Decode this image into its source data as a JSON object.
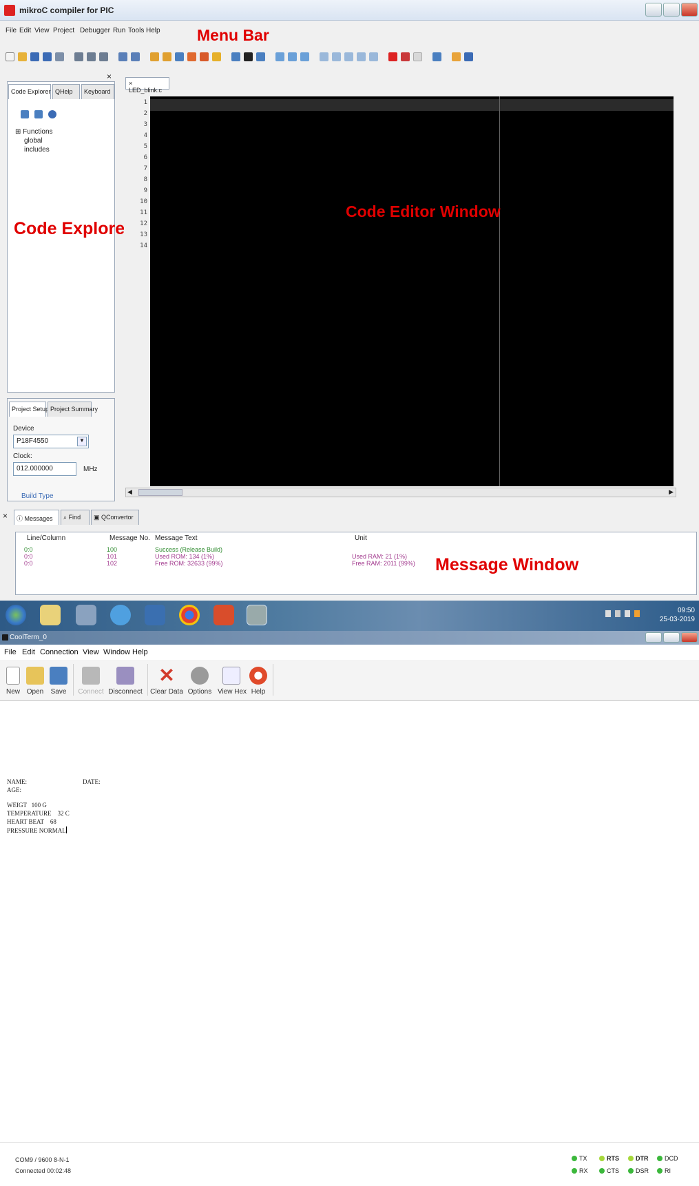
{
  "mikroc": {
    "title": "mikroC compiler for PIC",
    "menu": [
      "File",
      "Edit",
      "View",
      "Project",
      "Debugger",
      "Run",
      "Tools",
      "Help"
    ],
    "annotations": {
      "menu_bar": "Menu Bar",
      "code_explorer": "Code Explorer",
      "code_editor": "Code Editor Window",
      "message_window": "Message Window"
    },
    "explorer_tabs": [
      "Code Explorer",
      "QHelp",
      "Keyboard"
    ],
    "explorer_tree": [
      "Functions",
      "global",
      "includes"
    ],
    "setup_tabs": [
      "Project Setup",
      "Project Summary"
    ],
    "device_label": "Device",
    "device_value": "P18F4550",
    "clock_label": "Clock:",
    "clock_value": "012.000000",
    "clock_unit": "MHz",
    "build_type_label": "Build Type",
    "editor_tab": "LED_blink.c",
    "line_numbers": [
      "1",
      "2",
      "3",
      "4",
      "5",
      "6",
      "7",
      "8",
      "9",
      "10",
      "11",
      "12",
      "13",
      "14"
    ],
    "message_tabs": [
      "Messages",
      "Find",
      "QConvertor"
    ],
    "message_headers": [
      "Line/Column",
      "Message No.",
      "Message Text",
      "Unit"
    ],
    "messages": [
      {
        "line": "0:0",
        "no": "100",
        "text": "Success (Release Build)",
        "unit": ""
      },
      {
        "line": "0:0",
        "no": "101",
        "text": "Used ROM: 134 (1%)",
        "unit": "Used RAM: 21 (1%)"
      },
      {
        "line": "0:0",
        "no": "102",
        "text": "Free ROM: 32633 (99%)",
        "unit": "Free RAM: 2011 (99%)"
      }
    ]
  },
  "taskbar": {
    "time": "09:50",
    "date": "25-03-2019"
  },
  "coolterm": {
    "title": "CoolTerm_0",
    "menu": [
      "File",
      "Edit",
      "Connection",
      "View",
      "Window",
      "Help"
    ],
    "toolbar": {
      "new": "New",
      "open": "Open",
      "save": "Save",
      "connect": "Connect",
      "disconnect": "Disconnect",
      "clear": "Clear Data",
      "options": "Options",
      "viewhex": "View Hex",
      "help": "Help"
    },
    "terminal": {
      "name_label": "NAME:",
      "date_label": "DATE:",
      "age_label": "AGE:",
      "weight": "WEIGT   100 G",
      "temperature": "TEMPERATURE    32 C",
      "heart_beat": "HEART BEAT    68",
      "pressure": "PRESSURE NORMAL"
    },
    "status": {
      "port": "COM9 / 9600 8-N-1",
      "connected": "Connected 00:02:48",
      "leds": [
        "TX",
        "RTS",
        "DTR",
        "DCD",
        "RX",
        "CTS",
        "DSR",
        "RI"
      ]
    }
  },
  "colors": {
    "annotation_red": "#e00000",
    "editor_bg": "#000000",
    "success_green": "#2e8b2e",
    "info_purple": "#a23a8e",
    "led_green": "#3cb83c",
    "led_lime": "#a6d83a"
  }
}
